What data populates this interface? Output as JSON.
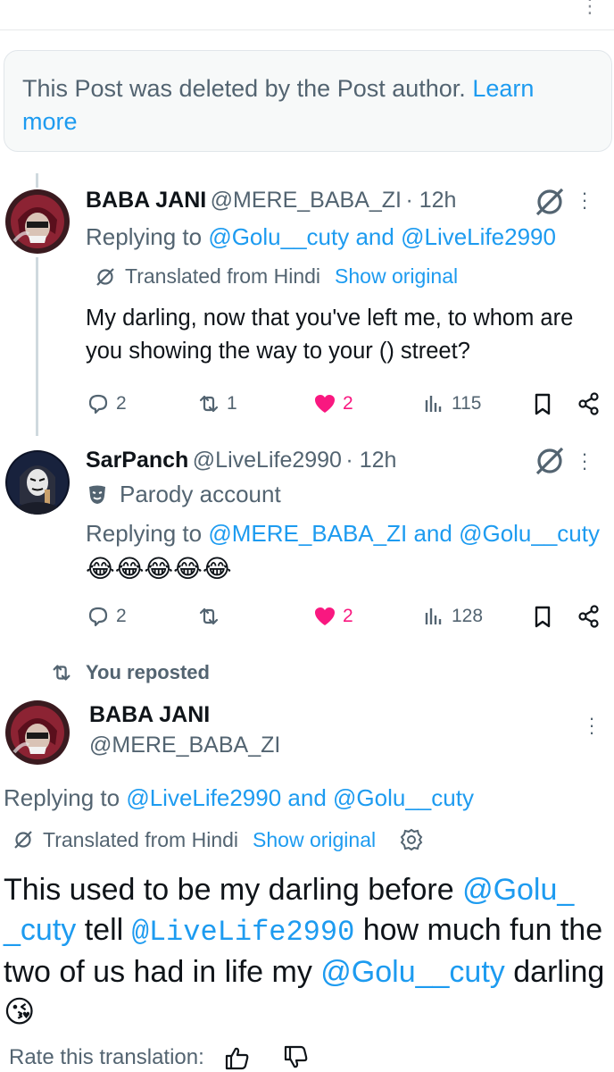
{
  "deleted_notice": {
    "text": "This Post was deleted by the Post author.",
    "link": "Learn more"
  },
  "post1": {
    "name": "BABA JANI",
    "handle": "@MERE_BABA_ZI",
    "time": "· 12h",
    "reply_prefix": "Replying to",
    "reply_user1": "@Golu__cuty",
    "reply_and": "and",
    "reply_user2": "@LiveLife2990",
    "translated_label": "Translated from Hindi",
    "show_original": "Show original",
    "text": "My darling, now that you've left me, to whom are you showing the way to your () street?",
    "replies": "2",
    "reposts": "1",
    "likes": "2",
    "views": "115"
  },
  "post2": {
    "name": "SarPanch",
    "handle": "@LiveLife2990",
    "time": "· 12h",
    "badge": "Parody account",
    "reply_prefix": "Replying to",
    "reply_user1": "@MERE_BABA_ZI",
    "reply_and": "and",
    "reply_user2": "@Golu__cuty",
    "text": "😂😂😂😂😂",
    "replies": "2",
    "reposts": "",
    "likes": "2",
    "views": "128"
  },
  "repost_label": "You reposted",
  "post3": {
    "name": "BABA JANI",
    "handle": "@MERE_BABA_ZI",
    "reply_prefix": "Replying to",
    "reply_user1": "@LiveLife2990",
    "reply_and": "and",
    "reply_user2": "@Golu__cuty",
    "translated_label": "Translated from Hindi",
    "show_original": "Show original",
    "text_1": "This used to be my darling before",
    "mention_1": "@Golu_\n_cuty",
    "text_2": "tell",
    "mention_2": "@LiveLife2990",
    "text_3": "how much fun the two of us had in life my",
    "mention_3": "@Golu__cuty",
    "text_4": "darling 😘",
    "rate_label": "Rate this translation:"
  },
  "colors": {
    "accent": "#1d9bf0",
    "like": "#f91880",
    "secondary": "#536471"
  },
  "icons": [
    "reply-icon",
    "repost-icon",
    "heart-icon",
    "views-icon",
    "bookmark-icon",
    "share-icon",
    "grok-icon",
    "more-icon",
    "translate-icon",
    "parody-mask-icon",
    "settings-icon",
    "thumbs-up-icon",
    "thumbs-down-icon"
  ]
}
